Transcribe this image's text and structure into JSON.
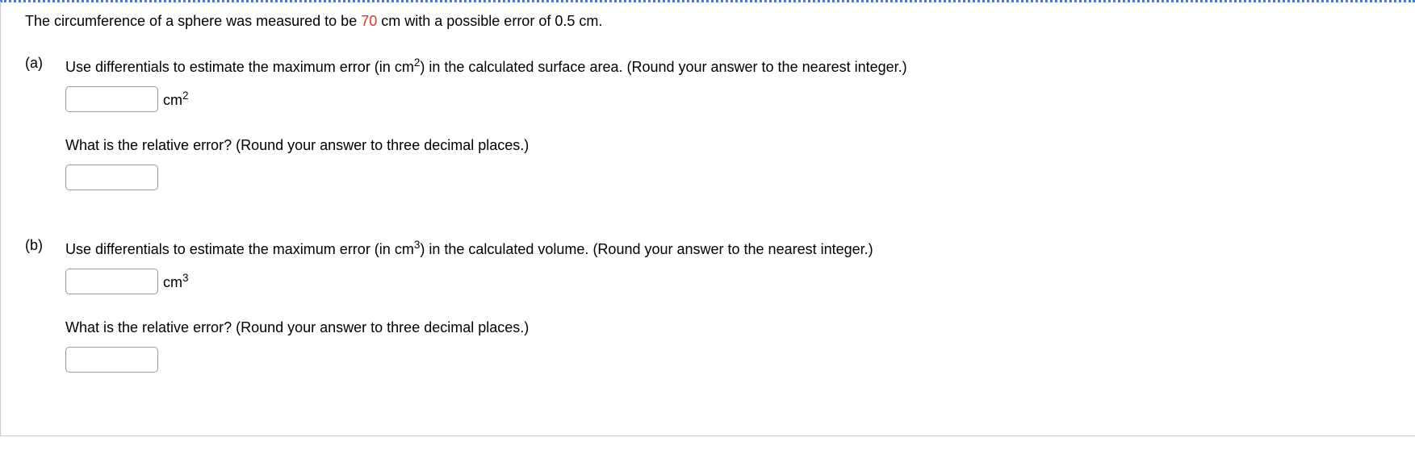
{
  "intro": {
    "pre": "The circumference of a sphere was measured to be ",
    "value": "70",
    "post": " cm with a possible error of 0.5 cm."
  },
  "parts": {
    "a": {
      "label": "(a)",
      "q1_pre": "Use differentials to estimate the maximum error (in cm",
      "q1_sup": "2",
      "q1_post": ") in the calculated surface area. (Round your answer to the nearest integer.)",
      "unit_base": "cm",
      "unit_sup": "2",
      "q2": "What is the relative error? (Round your answer to three decimal places.)"
    },
    "b": {
      "label": "(b)",
      "q1_pre": "Use differentials to estimate the maximum error (in cm",
      "q1_sup": "3",
      "q1_post": ") in the calculated volume. (Round your answer to the nearest integer.)",
      "unit_base": "cm",
      "unit_sup": "3",
      "q2": "What is the relative error? (Round your answer to three decimal places.)"
    }
  }
}
